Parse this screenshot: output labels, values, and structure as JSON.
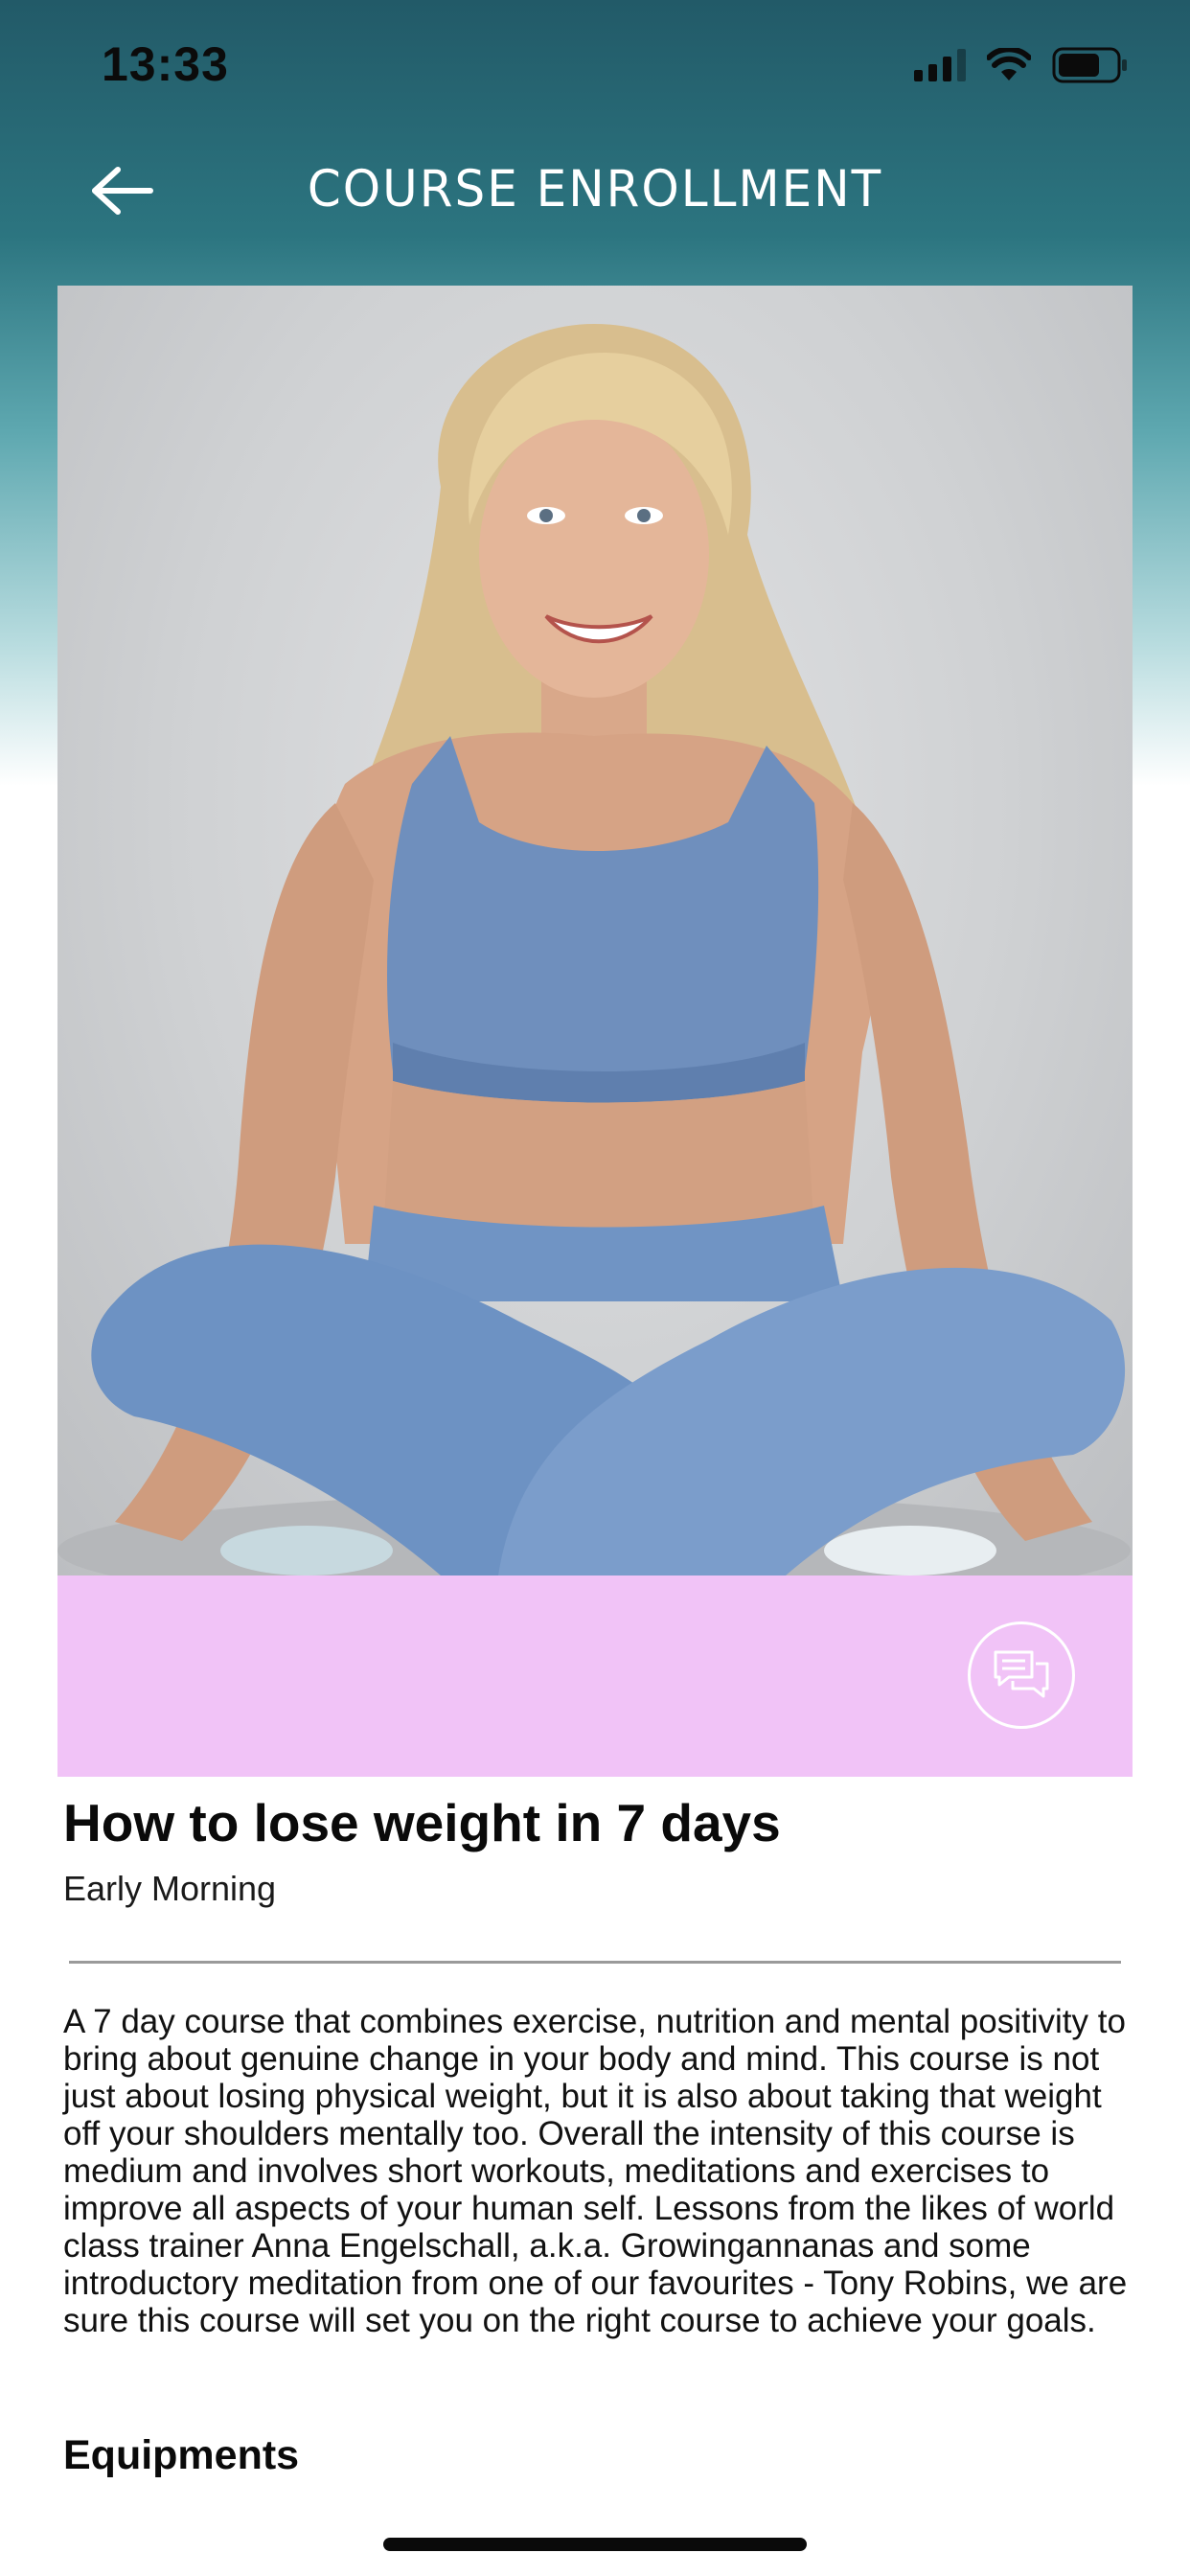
{
  "status_bar": {
    "time": "13:33"
  },
  "header": {
    "title": "COURSE ENROLLMENT",
    "back_icon": "arrow-left-icon"
  },
  "hero": {
    "image_alt": "Smiling blonde woman in blue sports bra and leggings sitting cross-legged",
    "banner_color": "#f1c3f7",
    "chat_icon": "chat-bubbles-icon"
  },
  "course": {
    "title": "How to lose weight in 7 days",
    "subtitle": "Early Morning",
    "description": "A 7 day course that combines exercise, nutrition and mental positivity to bring about genuine change in your body and mind. This course is not just about losing physical weight, but it is also about taking that weight off your shoulders mentally too. Overall the intensity of this course is medium and involves short workouts, meditations and exercises to improve all aspects of your human self. Lessons from the likes of world class trainer Anna Engelschall, a.k.a. Growingannanas and some introductory meditation from one of our favourites - Tony Robins, we are sure this course will set you on the right course to achieve your goals."
  },
  "sections": {
    "equipments_heading": "Equipments"
  },
  "colors": {
    "header_gradient_top": "#225a68",
    "header_gradient_mid": "#5ea8b0",
    "banner": "#f1c3f7",
    "divider": "#9a9a9a"
  }
}
